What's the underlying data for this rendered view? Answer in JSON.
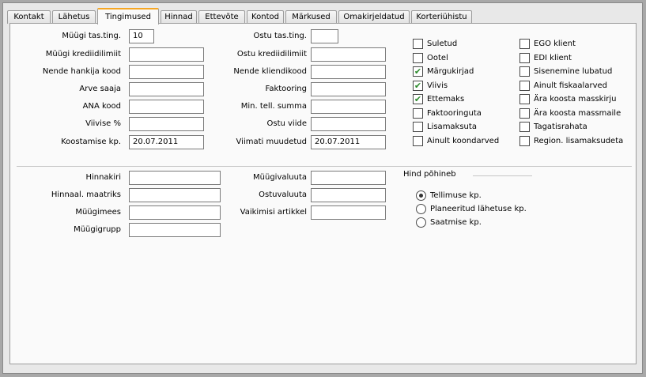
{
  "tabs": [
    "Kontakt",
    "Lähetus",
    "Tingimused",
    "Hinnad",
    "Ettevõte",
    "Kontod",
    "Märkused",
    "Omakirjeldatud",
    "Korteriühistu"
  ],
  "active_tab": "Tingimused",
  "terms": {
    "left_labels": [
      "Müügi tas.ting.",
      "Müügi krediidilimiit",
      "Nende hankija kood",
      "Arve saaja",
      "ANA kood",
      "Viivise %",
      "Koostamise kp."
    ],
    "left_values": [
      "10",
      "",
      "",
      "",
      "",
      "",
      "20.07.2011"
    ],
    "mid_labels": [
      "Ostu tas.ting.",
      "Ostu krediidilimiit",
      "Nende kliendikood",
      "Faktooring",
      "Min. tell. summa",
      "Ostu viide",
      "Viimati muudetud"
    ],
    "mid_values": [
      "",
      "",
      "",
      "",
      "",
      "",
      "20.07.2011"
    ]
  },
  "checkboxes_left": [
    {
      "label": "Suletud",
      "checked": false
    },
    {
      "label": "Ootel",
      "checked": false
    },
    {
      "label": "Märgukirjad",
      "checked": true
    },
    {
      "label": "Viivis",
      "checked": true
    },
    {
      "label": "Ettemaks",
      "checked": true
    },
    {
      "label": "Faktooringuta",
      "checked": false
    },
    {
      "label": "Lisamaksuta",
      "checked": false
    },
    {
      "label": "Ainult koondarved",
      "checked": false
    }
  ],
  "checkboxes_right": [
    {
      "label": "EGO klient",
      "checked": false
    },
    {
      "label": "EDI klient",
      "checked": false
    },
    {
      "label": "Sisenemine lubatud",
      "checked": false
    },
    {
      "label": "Ainult fiskaalarved",
      "checked": false
    },
    {
      "label": "Ära koosta masskirju",
      "checked": false
    },
    {
      "label": "Ära koosta massmaile",
      "checked": false
    },
    {
      "label": "Tagatisrahata",
      "checked": false
    },
    {
      "label": "Region. lisamaksudeta",
      "checked": false
    }
  ],
  "pricing": {
    "left_labels": [
      "Hinnakiri",
      "Hinnaal. maatriks",
      "Müügimees",
      "Müügigrupp"
    ],
    "left_values": [
      "",
      "",
      "",
      ""
    ],
    "mid_labels": [
      "Müügivaluuta",
      "Ostuvaluuta",
      "Vaikimisi artikkel"
    ],
    "mid_values": [
      "",
      "",
      ""
    ]
  },
  "price_basis": {
    "title": "Hind põhineb",
    "options": [
      "Tellimuse kp.",
      "Planeeritud lähetuse kp.",
      "Saatmise kp."
    ],
    "selected": 0
  }
}
